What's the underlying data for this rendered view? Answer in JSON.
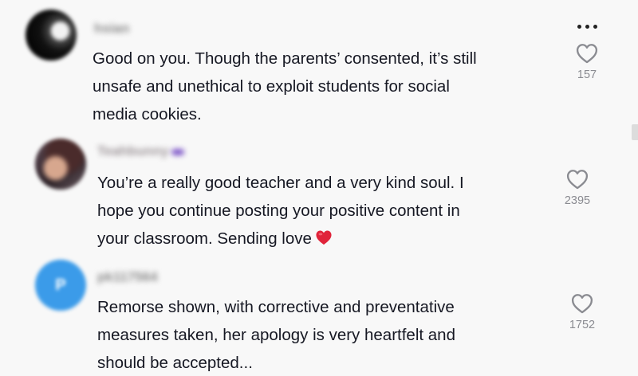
{
  "comments": [
    {
      "username": "hsian",
      "avatar_icon": "avatar-dark-icon",
      "text": "Good on you. Though the parents’ consented, it’s still\nunsafe and unethical to exploit students for social\nmedia cookies.",
      "likes": "157"
    },
    {
      "username": "Teahbunny",
      "avatar_icon": "avatar-photo-icon",
      "text": "You’re a really good teacher and a very kind soul. I\nhope you continue posting your positive content in\nyour classroom. Sending love",
      "emoji": "❤️",
      "likes": "2395"
    },
    {
      "username": "pk117564",
      "avatar_icon": "avatar-initial-icon",
      "avatar_initial": "P",
      "text": "Remorse shown, with corrective and preventative\nmeasures taken, her apology is very heartfelt and\nshould be accepted...",
      "likes": "1752"
    }
  ],
  "icons": {
    "more": "more-options-icon",
    "like": "heart-outline-icon"
  },
  "colors": {
    "background": "#f8f8f8",
    "text": "#161823",
    "muted": "#8a8b91",
    "avatar_blue": "#3b9be9",
    "emoji_red": "#e0243a"
  }
}
